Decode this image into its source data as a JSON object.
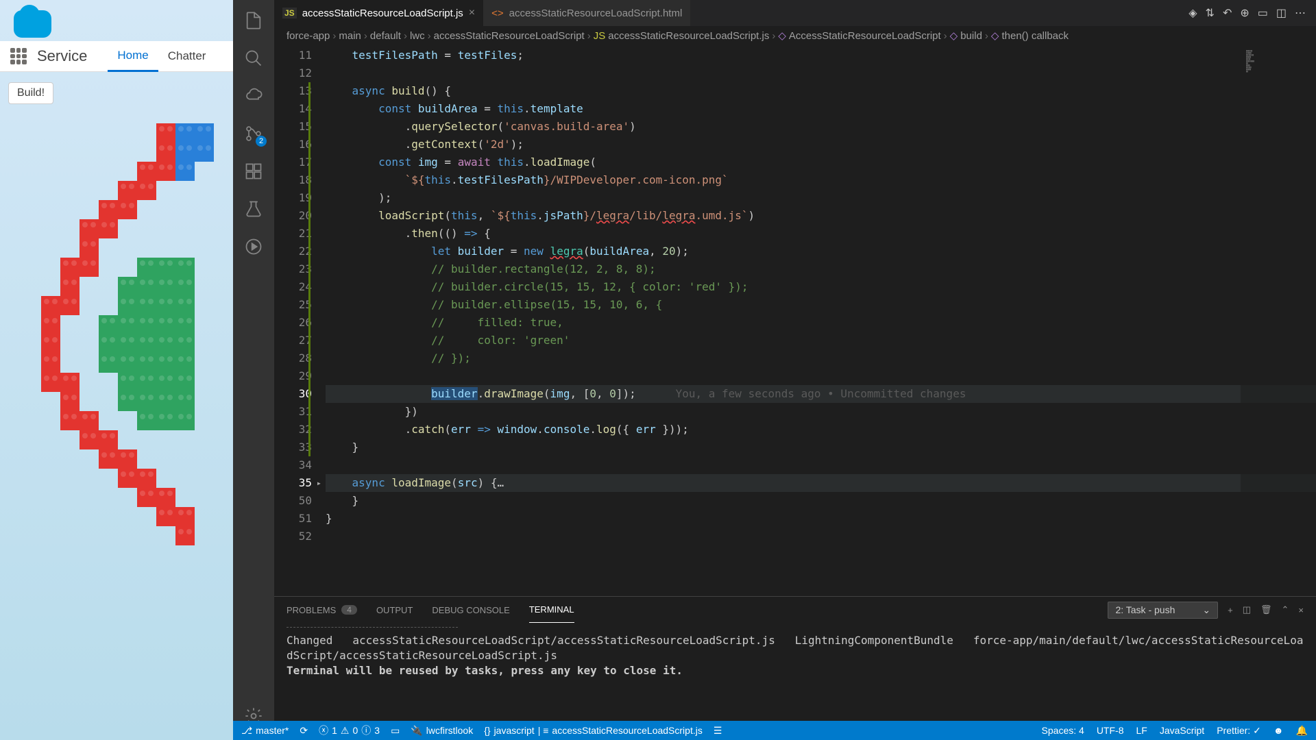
{
  "salesforce": {
    "title": "Service",
    "tabs": [
      "Home",
      "Chatter"
    ],
    "button": "Build!"
  },
  "vscode": {
    "tabs": [
      {
        "icon": "JS",
        "label": "accessStaticResourceLoadScript.js",
        "active": true
      },
      {
        "icon": "<>",
        "label": "accessStaticResourceLoadScript.html",
        "active": false
      }
    ],
    "scm_badge": "2",
    "breadcrumbs": [
      "force-app",
      "main",
      "default",
      "lwc",
      "accessStaticResourceLoadScript",
      "accessStaticResourceLoadScript.js",
      "AccessStaticResourceLoadScript",
      "build",
      "then() callback"
    ],
    "gutter_start": 11,
    "code_lines": [
      {
        "n": 11,
        "html": "    <span class='var'>testFilesPath</span> <span class='op'>=</span> <span class='var'>testFiles</span>;"
      },
      {
        "n": 12,
        "html": ""
      },
      {
        "n": 13,
        "html": "    <span class='kw2'>async</span> <span class='fn'>build</span>() {"
      },
      {
        "n": 14,
        "html": "        <span class='kw2'>const</span> <span class='var'>buildArea</span> <span class='op'>=</span> <span class='kw2'>this</span>.<span class='var'>template</span>"
      },
      {
        "n": 15,
        "html": "            .<span class='fn'>querySelector</span>(<span class='str'>'canvas.build-area'</span>)"
      },
      {
        "n": 16,
        "html": "            .<span class='fn'>getContext</span>(<span class='str'>'2d'</span>);"
      },
      {
        "n": 17,
        "html": "        <span class='kw2'>const</span> <span class='var'>img</span> <span class='op'>=</span> <span class='kw'>await</span> <span class='kw2'>this</span>.<span class='fn'>loadImage</span>("
      },
      {
        "n": 18,
        "html": "            <span class='str'>`${</span><span class='kw2'>this</span>.<span class='var'>testFilesPath</span><span class='str'>}/WIPDeveloper.com-icon.png`</span>"
      },
      {
        "n": 19,
        "html": "        );"
      },
      {
        "n": 20,
        "html": "        <span class='fn'>loadScript</span>(<span class='kw2'>this</span>, <span class='str'>`${</span><span class='kw2'>this</span>.<span class='var'>jsPath</span><span class='str'>}/<span class='squiggle'>legra</span>/lib/<span class='squiggle'>legra</span>.umd.js`</span>)"
      },
      {
        "n": 21,
        "html": "            .<span class='fn'>then</span>(() <span class='kw2'>=&gt;</span> {"
      },
      {
        "n": 22,
        "html": "                <span class='kw2'>let</span> <span class='var'>builder</span> <span class='op'>=</span> <span class='kw2'>new</span> <span class='cls squiggle'>legra</span>(<span class='var'>buildArea</span>, <span class='num'>20</span>);"
      },
      {
        "n": 23,
        "html": "                <span class='cmt'>// builder.rectangle(12, 2, 8, 8);</span>"
      },
      {
        "n": 24,
        "html": "                <span class='cmt'>// builder.circle(15, 15, 12, { color: 'red' });</span>"
      },
      {
        "n": 25,
        "html": "                <span class='cmt'>// builder.ellipse(15, 15, 10, 6, {</span>"
      },
      {
        "n": 26,
        "html": "                <span class='cmt'>//     filled: true,</span>"
      },
      {
        "n": 27,
        "html": "                <span class='cmt'>//     color: 'green'</span>"
      },
      {
        "n": 28,
        "html": "                <span class='cmt'>// });</span>"
      },
      {
        "n": 29,
        "html": ""
      },
      {
        "n": 30,
        "hl": true,
        "html": "                <span class='sel var'>builder</span>.<span class='fn'>drawImage</span>(<span class='var'>img</span>, [<span class='num'>0</span>, <span class='num'>0</span>]);      <span class='blame'>You, a few seconds ago • Uncommitted changes</span>"
      },
      {
        "n": 31,
        "html": "            })"
      },
      {
        "n": 32,
        "html": "            .<span class='fn'>catch</span>(<span class='var'>err</span> <span class='kw2'>=&gt;</span> <span class='var'>window</span>.<span class='var'>console</span>.<span class='fn'>log</span>({ <span class='var'>err</span> }));"
      },
      {
        "n": 33,
        "html": "    }"
      },
      {
        "n": 34,
        "html": ""
      },
      {
        "n": 35,
        "fold": true,
        "hl": true,
        "html": "    <span class='kw2'>async</span> <span class='fn'>loadImage</span>(<span class='var'>src</span>) {<span class='op'>…</span>"
      },
      {
        "n": 50,
        "html": "    }"
      },
      {
        "n": 51,
        "html": "}"
      },
      {
        "n": 52,
        "html": ""
      }
    ],
    "panel": {
      "tabs": [
        {
          "label": "PROBLEMS",
          "badge": "4"
        },
        {
          "label": "OUTPUT"
        },
        {
          "label": "DEBUG CONSOLE"
        },
        {
          "label": "TERMINAL",
          "active": true
        }
      ],
      "task": "2: Task - push",
      "terminal": [
        "Changed   accessStaticResourceLoadScript/accessStaticResourceLoadScript.js   LightningComponentBundle   force-app/main/default/lwc/accessStaticResourceLoadScript/accessStaticResourceLoadScript.js",
        "",
        "Terminal will be reused by tasks, press any key to close it."
      ]
    },
    "statusbar": {
      "branch": "master*",
      "errors": "1",
      "warnings": "0",
      "info": "3",
      "org": "lwcfirstlook",
      "lang": "javascript",
      "file": "accessStaticResourceLoadScript.js",
      "spaces": "Spaces: 4",
      "encoding": "UTF-8",
      "eol": "LF",
      "mode": "JavaScript",
      "prettier": "Prettier: ✓"
    }
  }
}
